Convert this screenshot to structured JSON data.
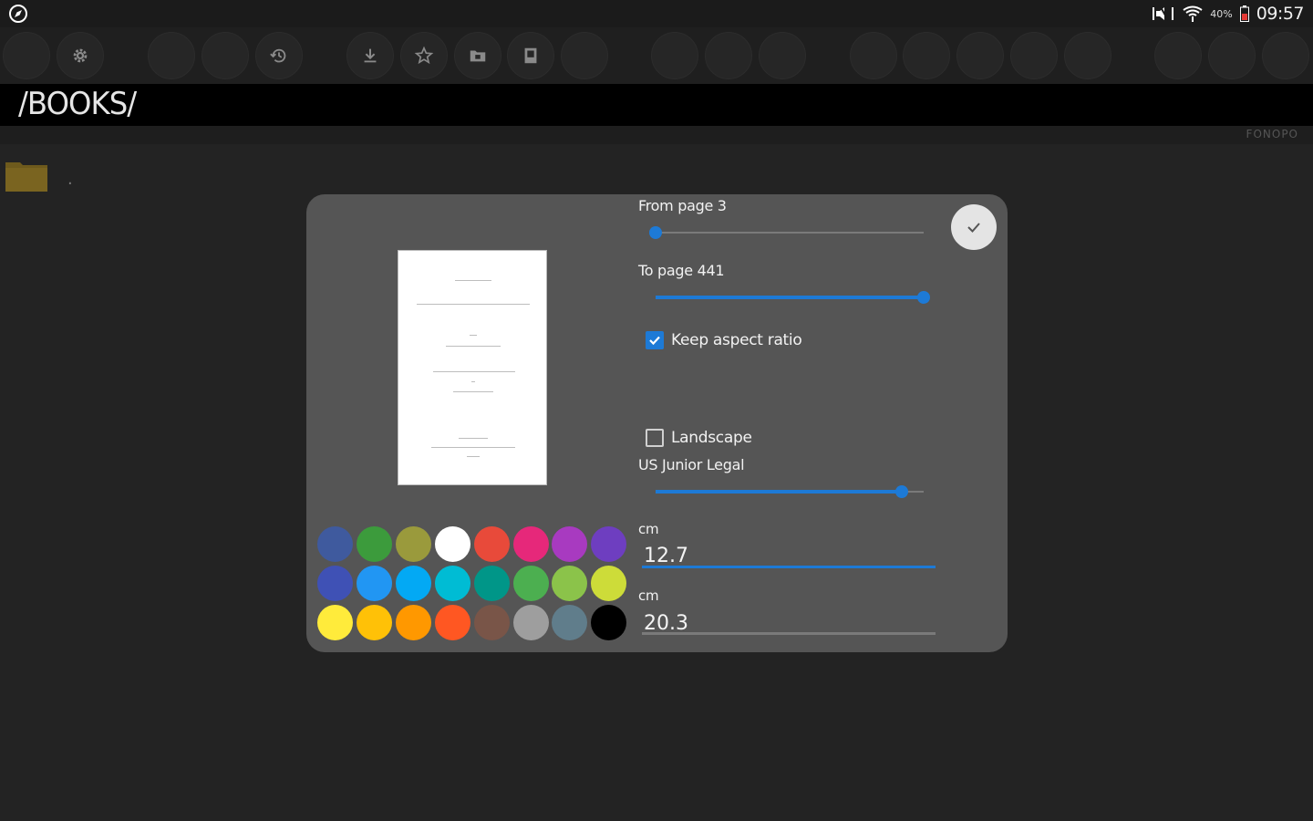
{
  "status_bar": {
    "battery": "40%",
    "time": "09:57"
  },
  "header": {
    "title": "/BOOKS/",
    "watermark": "FONOPO"
  },
  "file_list": {
    "items": [
      {
        "name": "."
      }
    ]
  },
  "dialog": {
    "from_page": {
      "label": "From page 3",
      "value": 3,
      "max": 441
    },
    "to_page": {
      "label": "To page 441",
      "value": 441,
      "max": 441
    },
    "keep_aspect": {
      "label": "Keep aspect ratio",
      "checked": true
    },
    "landscape": {
      "label": "Landscape",
      "checked": false
    },
    "paper_size": {
      "label": "US Junior Legal",
      "fraction": 0.92
    },
    "width": {
      "unit": "cm",
      "value": "12.7"
    },
    "height": {
      "unit": "cm",
      "value": "20.3"
    },
    "palette": [
      "#3f5a9e",
      "#3c9b3c",
      "#9a9a3c",
      "#ffffff",
      "#e84a3a",
      "#e6287a",
      "#a83ac0",
      "#6e3ec0",
      "#3f51b5",
      "#2196f3",
      "#03a9f4",
      "#00bcd4",
      "#009688",
      "#4caf50",
      "#8bc34a",
      "#cddc39",
      "#ffeb3b",
      "#ffc107",
      "#ff9800",
      "#ff5722",
      "#795548",
      "#9e9e9e",
      "#607d8b",
      "#000000"
    ],
    "accent_color": "#1d7ad6"
  }
}
